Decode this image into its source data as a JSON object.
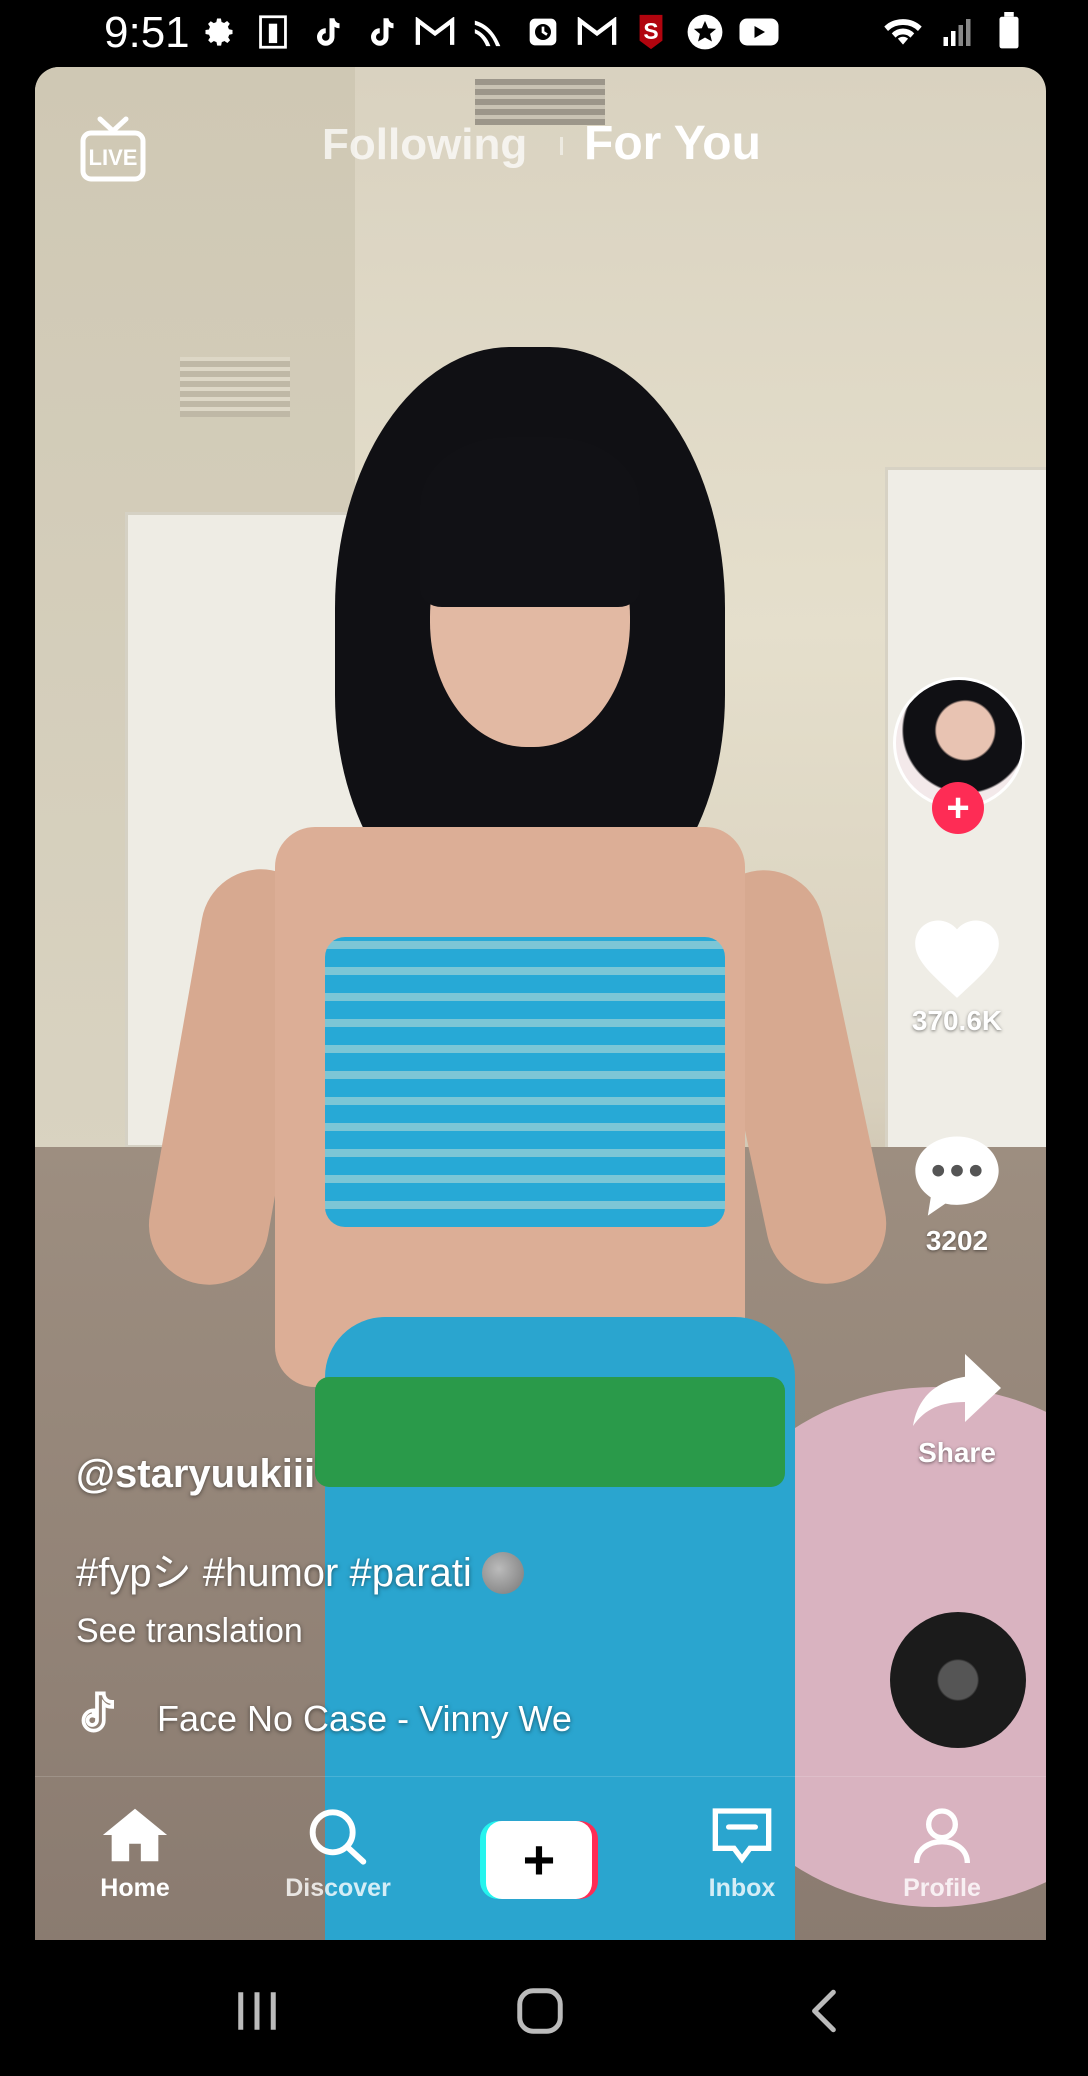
{
  "status_bar": {
    "time": "9:51",
    "notification_icons": [
      "gear-icon",
      "calendar-icon",
      "tiktok-icon",
      "tiktok-icon",
      "gmail-icon",
      "sprint-icon",
      "alarm-icon",
      "gmail-icon",
      "stanford-icon",
      "star-icon",
      "youtube-icon"
    ],
    "right_icons": [
      "wifi-icon",
      "signal-icon",
      "battery-icon"
    ]
  },
  "top_nav": {
    "live_label": "LIVE",
    "tabs": [
      {
        "label": "Following",
        "active": false
      },
      {
        "label": "For You",
        "active": true
      }
    ]
  },
  "side_rail": {
    "likes": "370.6K",
    "comments": "3202",
    "share_label": "Share"
  },
  "caption": {
    "username": "@staryuukiii",
    "hashtags": "#fypシ #humor #parati",
    "see_translation": "See translation",
    "sound": "Face No Case - Vinny We"
  },
  "bottom_nav": {
    "items": [
      {
        "label": "Home",
        "icon": "home-icon",
        "active": true
      },
      {
        "label": "Discover",
        "icon": "search-icon",
        "active": false
      },
      {
        "label": "",
        "icon": "plus-icon",
        "active": false
      },
      {
        "label": "Inbox",
        "icon": "inbox-icon",
        "active": false
      },
      {
        "label": "Profile",
        "icon": "profile-icon",
        "active": false
      }
    ]
  },
  "system_nav": [
    "recent-apps-icon",
    "home-circle-icon",
    "back-icon"
  ],
  "colors": {
    "accent_red": "#fe2c55",
    "accent_cyan": "#25f4ee"
  }
}
